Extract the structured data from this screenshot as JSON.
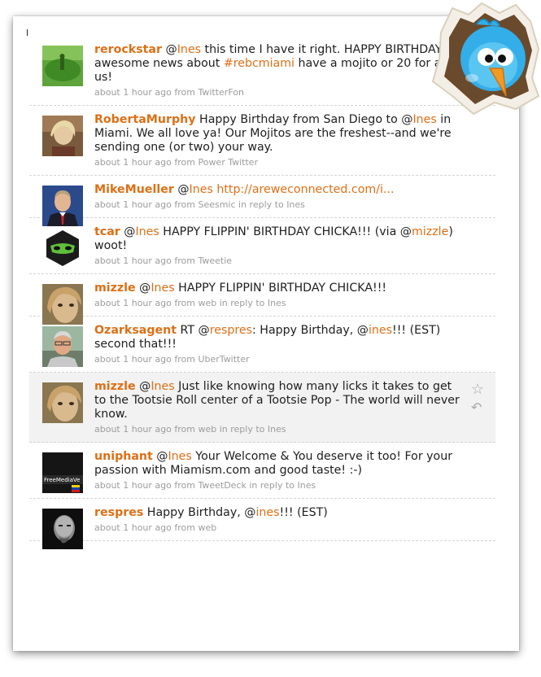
{
  "colors": {
    "accent": "#dd6f16",
    "text": "#1e1e1e",
    "meta": "#9c9c9c"
  },
  "tweets": [
    {
      "user": "rerockstar",
      "parts": [
        " @",
        "Ines",
        " this time I have it right. HAPPY BIRTHDAY!!! awesome news about ",
        "#rebcmiami",
        " have a mojito or 20 for all of us!"
      ],
      "meta": "about 1 hour ago from TwitterFon"
    },
    {
      "user": "RobertaMurphy",
      "parts": [
        " Happy Birthday from San Diego to @",
        "Ines",
        " in Miami. We all love ya! Our Mojitos are the freshest--and we're sending one (or two) your way."
      ],
      "meta": "about 1 hour ago from Power Twitter"
    },
    {
      "user": "MikeMueller",
      "parts": [
        " @",
        "Ines",
        " ",
        "http://areweconnected.com/i..."
      ],
      "meta": "about 1 hour ago from Seesmic in reply to Ines"
    },
    {
      "user": "tcar",
      "parts": [
        " @",
        "Ines",
        " HAPPY FLIPPIN' BIRTHDAY CHICKA!!! (via @",
        "mizzle",
        ") woot!"
      ],
      "meta": "about 1 hour ago from Tweetie"
    },
    {
      "user": "mizzle",
      "parts": [
        " @",
        "Ines",
        " HAPPY FLIPPIN' BIRTHDAY CHICKA!!!"
      ],
      "meta": "about 1 hour ago from web in reply to Ines"
    },
    {
      "user": "Ozarksagent",
      "parts": [
        " RT @",
        "respres",
        ": Happy Birthday, @",
        "ines",
        "!!! (EST) second that!!!"
      ],
      "meta": "about 1 hour ago from UberTwitter"
    },
    {
      "user": "mizzle",
      "parts": [
        " @",
        "Ines",
        " Just like knowing how many licks it takes to get to the Tootsie Roll center of a Tootsie Pop - The world will never know."
      ],
      "meta": "about 1 hour ago from web in reply to Ines"
    },
    {
      "user": "uniphant",
      "parts": [
        " @",
        "Ines",
        " Your Welcome & You deserve it too! For your passion with Miamism.com and good taste! :-)"
      ],
      "meta": "about 1 hour ago from TweetDeck in reply to Ines",
      "avatar_caption": "FreeMediaVe"
    },
    {
      "user": "respres",
      "parts": [
        " Happy Birthday, @",
        "ines",
        "!!! (EST)"
      ],
      "meta": "about 1 hour ago from web"
    }
  ]
}
